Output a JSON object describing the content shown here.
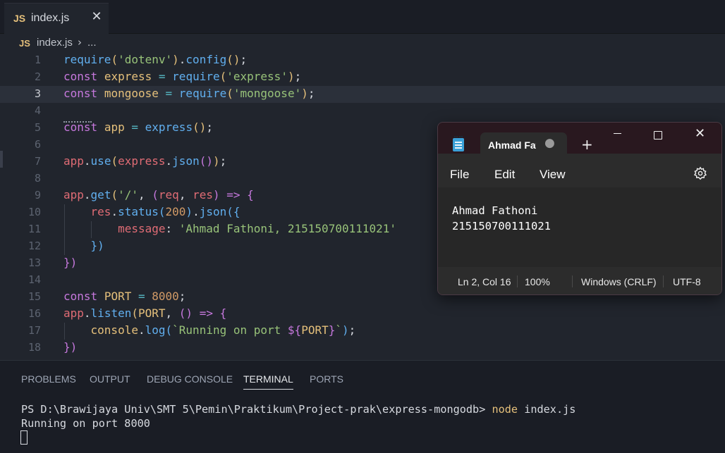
{
  "editor_tab": {
    "icon": "JS",
    "filename": "index.js",
    "close": "✕"
  },
  "breadcrumb": {
    "icon": "JS",
    "file": "index.js",
    "separator": "›",
    "more": "..."
  },
  "line_numbers": [
    "1",
    "2",
    "3",
    "4",
    "5",
    "6",
    "7",
    "8",
    "9",
    "10",
    "11",
    "12",
    "13",
    "14",
    "15",
    "16",
    "17",
    "18"
  ],
  "current_line": "3",
  "code_lines": [
    "require('dotenv').config();",
    "const express = require('express');",
    "const mongoose = require('mongoose');",
    "",
    "const app = express();",
    "",
    "app.use(express.json());",
    "",
    "app.get('/', (req, res) => {",
    "    res.status(200).json({",
    "        message: 'Ahmad Fathoni, 215150700111021'",
    "    })",
    "})",
    "",
    "const PORT = 8000;",
    "app.listen(PORT, () => {",
    "    console.log(`Running on port ${PORT}`);",
    "})"
  ],
  "panel": {
    "tabs": [
      "PROBLEMS",
      "OUTPUT",
      "DEBUG CONSOLE",
      "TERMINAL",
      "PORTS"
    ],
    "active_tab": "TERMINAL",
    "terminal": {
      "prompt": "PS D:\\Brawijaya Univ\\SMT 5\\Pemin\\Praktikum\\Project-prak\\express-mongodb> ",
      "command": "node",
      "args": " index.js",
      "output": "Running on port 8000"
    }
  },
  "notepad": {
    "tab_title": "Ahmad Fathoni",
    "unsaved_dot": "●",
    "new_tab": "+",
    "close": "✕",
    "menu": {
      "file": "File",
      "edit": "Edit",
      "view": "View"
    },
    "content": [
      "Ahmad Fathoni",
      "215150700111021"
    ],
    "status": {
      "position": "Ln 2, Col 16",
      "zoom": "100%",
      "line_ending": "Windows (CRLF)",
      "encoding": "UTF-8"
    }
  },
  "colors": {
    "keyword": "#c678dd",
    "function": "#61afef",
    "string": "#98c379",
    "variable": "#e06c75",
    "constant": "#e5c07b",
    "number": "#d19a66",
    "editor_bg": "#21252d"
  }
}
